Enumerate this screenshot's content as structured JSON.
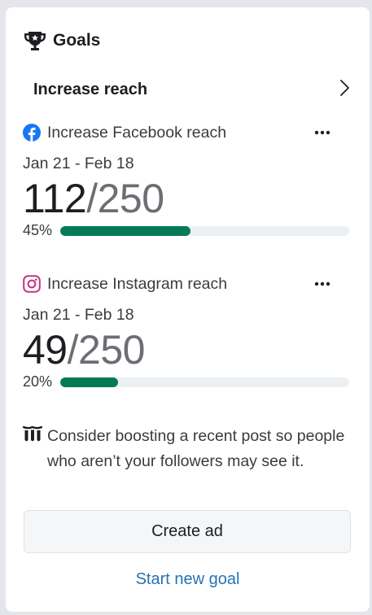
{
  "header": {
    "title": "Goals",
    "icon": "trophy-icon"
  },
  "section": {
    "label": "Increase reach",
    "icon": "chevron-right-icon"
  },
  "goals": [
    {
      "platform_icon": "facebook-icon",
      "name": "Increase Facebook reach",
      "dates": "Jan 21 - Feb 18",
      "current": "112",
      "target": "/250",
      "percent_label": "45%",
      "progress": 0.45
    },
    {
      "platform_icon": "instagram-icon",
      "name": "Increase Instagram reach",
      "dates": "Jan 21 - Feb 18",
      "current": "49",
      "target": "/250",
      "percent_label": "20%",
      "progress": 0.2
    }
  ],
  "tip": {
    "icon": "audience-icon",
    "text": "Consider boosting a recent post so people who aren’t your followers may see it."
  },
  "actions": {
    "create_ad_label": "Create ad",
    "start_goal_label": "Start new goal"
  },
  "colors": {
    "progress_fill": "#067a57",
    "progress_track": "#edf0f3",
    "link": "#2773b3",
    "facebook": "#1877f2",
    "instagram": "#c13584"
  }
}
